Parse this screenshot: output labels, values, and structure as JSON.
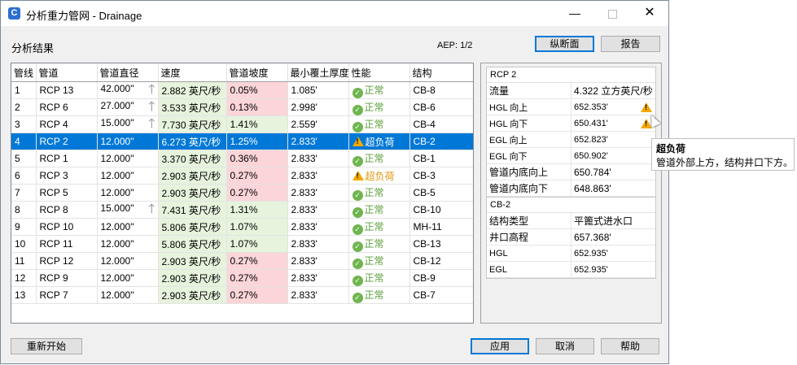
{
  "window": {
    "title": "分析重力管网 - Drainage",
    "app_icon_letter": "C",
    "minimize_glyph": "—",
    "close_glyph": "✕"
  },
  "section_label": "分析结果",
  "aep": "AEP: 1/2",
  "buttons": {
    "profile": "纵断面",
    "report": "报告",
    "restart": "重新开始",
    "apply": "应用",
    "cancel": "取消",
    "help": "帮助"
  },
  "grid": {
    "headers": [
      "管线",
      "管道",
      "管道直径",
      "速度",
      "管道坡度",
      "最小覆土厚度",
      "性能",
      "结构"
    ],
    "rows": [
      {
        "line": "1",
        "pipe": "RCP 13",
        "diameter": "42.000\"",
        "arrow": true,
        "velocity": "2.882 英尺/秒",
        "slope": "0.05%",
        "cover": "1.085'",
        "status": "正常",
        "status_type": "ok",
        "structure": "CB-8",
        "slope_color": "red",
        "selected": false
      },
      {
        "line": "2",
        "pipe": "RCP 6",
        "diameter": "27.000\"",
        "arrow": true,
        "velocity": "3.533 英尺/秒",
        "slope": "0.13%",
        "cover": "2.998'",
        "status": "正常",
        "status_type": "ok",
        "structure": "CB-6",
        "slope_color": "red",
        "selected": false
      },
      {
        "line": "3",
        "pipe": "RCP 4",
        "diameter": "15.000\"",
        "arrow": true,
        "velocity": "7.730 英尺/秒",
        "slope": "1.41%",
        "cover": "2.559'",
        "status": "正常",
        "status_type": "ok",
        "structure": "CB-4",
        "slope_color": "green",
        "selected": false
      },
      {
        "line": "4",
        "pipe": "RCP 2",
        "diameter": "12.000\"",
        "arrow": false,
        "velocity": "6.273 英尺/秒",
        "slope": "1.25%",
        "cover": "2.833'",
        "status": "超负荷",
        "status_type": "warn",
        "structure": "CB-2",
        "slope_color": "green",
        "selected": true
      },
      {
        "line": "5",
        "pipe": "RCP 1",
        "diameter": "12.000\"",
        "arrow": false,
        "velocity": "3.370 英尺/秒",
        "slope": "0.36%",
        "cover": "2.833'",
        "status": "正常",
        "status_type": "ok",
        "structure": "CB-1",
        "slope_color": "red",
        "selected": false
      },
      {
        "line": "6",
        "pipe": "RCP 3",
        "diameter": "12.000\"",
        "arrow": false,
        "velocity": "2.903 英尺/秒",
        "slope": "0.27%",
        "cover": "2.833'",
        "status": "超负荷",
        "status_type": "warn",
        "structure": "CB-3",
        "slope_color": "red",
        "selected": false
      },
      {
        "line": "7",
        "pipe": "RCP 5",
        "diameter": "12.000\"",
        "arrow": false,
        "velocity": "2.903 英尺/秒",
        "slope": "0.27%",
        "cover": "2.833'",
        "status": "正常",
        "status_type": "ok",
        "structure": "CB-5",
        "slope_color": "red",
        "selected": false
      },
      {
        "line": "8",
        "pipe": "RCP 8",
        "diameter": "15.000\"",
        "arrow": true,
        "velocity": "7.431 英尺/秒",
        "slope": "1.31%",
        "cover": "2.833'",
        "status": "正常",
        "status_type": "ok",
        "structure": "CB-10",
        "slope_color": "green",
        "selected": false
      },
      {
        "line": "9",
        "pipe": "RCP 10",
        "diameter": "12.000\"",
        "arrow": false,
        "velocity": "5.806 英尺/秒",
        "slope": "1.07%",
        "cover": "2.833'",
        "status": "正常",
        "status_type": "ok",
        "structure": "MH-11",
        "slope_color": "green",
        "selected": false
      },
      {
        "line": "10",
        "pipe": "RCP 11",
        "diameter": "12.000\"",
        "arrow": false,
        "velocity": "5.806 英尺/秒",
        "slope": "1.07%",
        "cover": "2.833'",
        "status": "正常",
        "status_type": "ok",
        "structure": "CB-13",
        "slope_color": "green",
        "selected": false
      },
      {
        "line": "11",
        "pipe": "RCP 12",
        "diameter": "12.000\"",
        "arrow": false,
        "velocity": "2.903 英尺/秒",
        "slope": "0.27%",
        "cover": "2.833'",
        "status": "正常",
        "status_type": "ok",
        "structure": "CB-12",
        "slope_color": "red",
        "selected": false
      },
      {
        "line": "12",
        "pipe": "RCP 9",
        "diameter": "12.000\"",
        "arrow": false,
        "velocity": "2.903 英尺/秒",
        "slope": "0.27%",
        "cover": "2.833'",
        "status": "正常",
        "status_type": "ok",
        "structure": "CB-9",
        "slope_color": "red",
        "selected": false
      },
      {
        "line": "13",
        "pipe": "RCP 7",
        "diameter": "12.000\"",
        "arrow": false,
        "velocity": "2.903 英尺/秒",
        "slope": "0.27%",
        "cover": "2.833'",
        "status": "正常",
        "status_type": "ok",
        "structure": "CB-7",
        "slope_color": "red",
        "selected": false
      }
    ]
  },
  "pipe_props": {
    "title": "RCP 2",
    "rows": [
      {
        "key": "流量",
        "value": "4.322 立方英尺/秒",
        "warn": false,
        "small": false
      },
      {
        "key": "HGL 向上",
        "value": "652.353'",
        "warn": true,
        "small": true
      },
      {
        "key": "HGL 向下",
        "value": "650.431'",
        "warn": true,
        "small": true
      },
      {
        "key": "EGL 向上",
        "value": "652.823'",
        "warn": false,
        "small": true
      },
      {
        "key": "EGL 向下",
        "value": "650.902'",
        "warn": false,
        "small": true
      },
      {
        "key": "管道内底向上",
        "value": "650.784'",
        "warn": false,
        "small": false
      },
      {
        "key": "管道内底向下",
        "value": "648.863'",
        "warn": false,
        "small": false
      }
    ]
  },
  "structure_props": {
    "title": "CB-2",
    "rows": [
      {
        "key": "结构类型",
        "value": "平篦式进水口",
        "small": false
      },
      {
        "key": "井口高程",
        "value": "657.368'",
        "small": false
      },
      {
        "key": "HGL",
        "value": "652.935'",
        "small": true
      },
      {
        "key": "EGL",
        "value": "652.935'",
        "small": true
      }
    ]
  },
  "tooltip": {
    "title": "超负荷",
    "body": "管道外部上方，结构井口下方。"
  },
  "colors": {
    "selection": "#0078d7",
    "good_cell": "#e6f3dd",
    "bad_cell": "#fbd5d8",
    "ok_green": "#6fb54f",
    "warn_orange": "#f2a900"
  },
  "icons": {
    "ok": "check-circle-icon",
    "warn": "warning-triangle-icon",
    "flow_arrow": "up-arrow-icon"
  }
}
